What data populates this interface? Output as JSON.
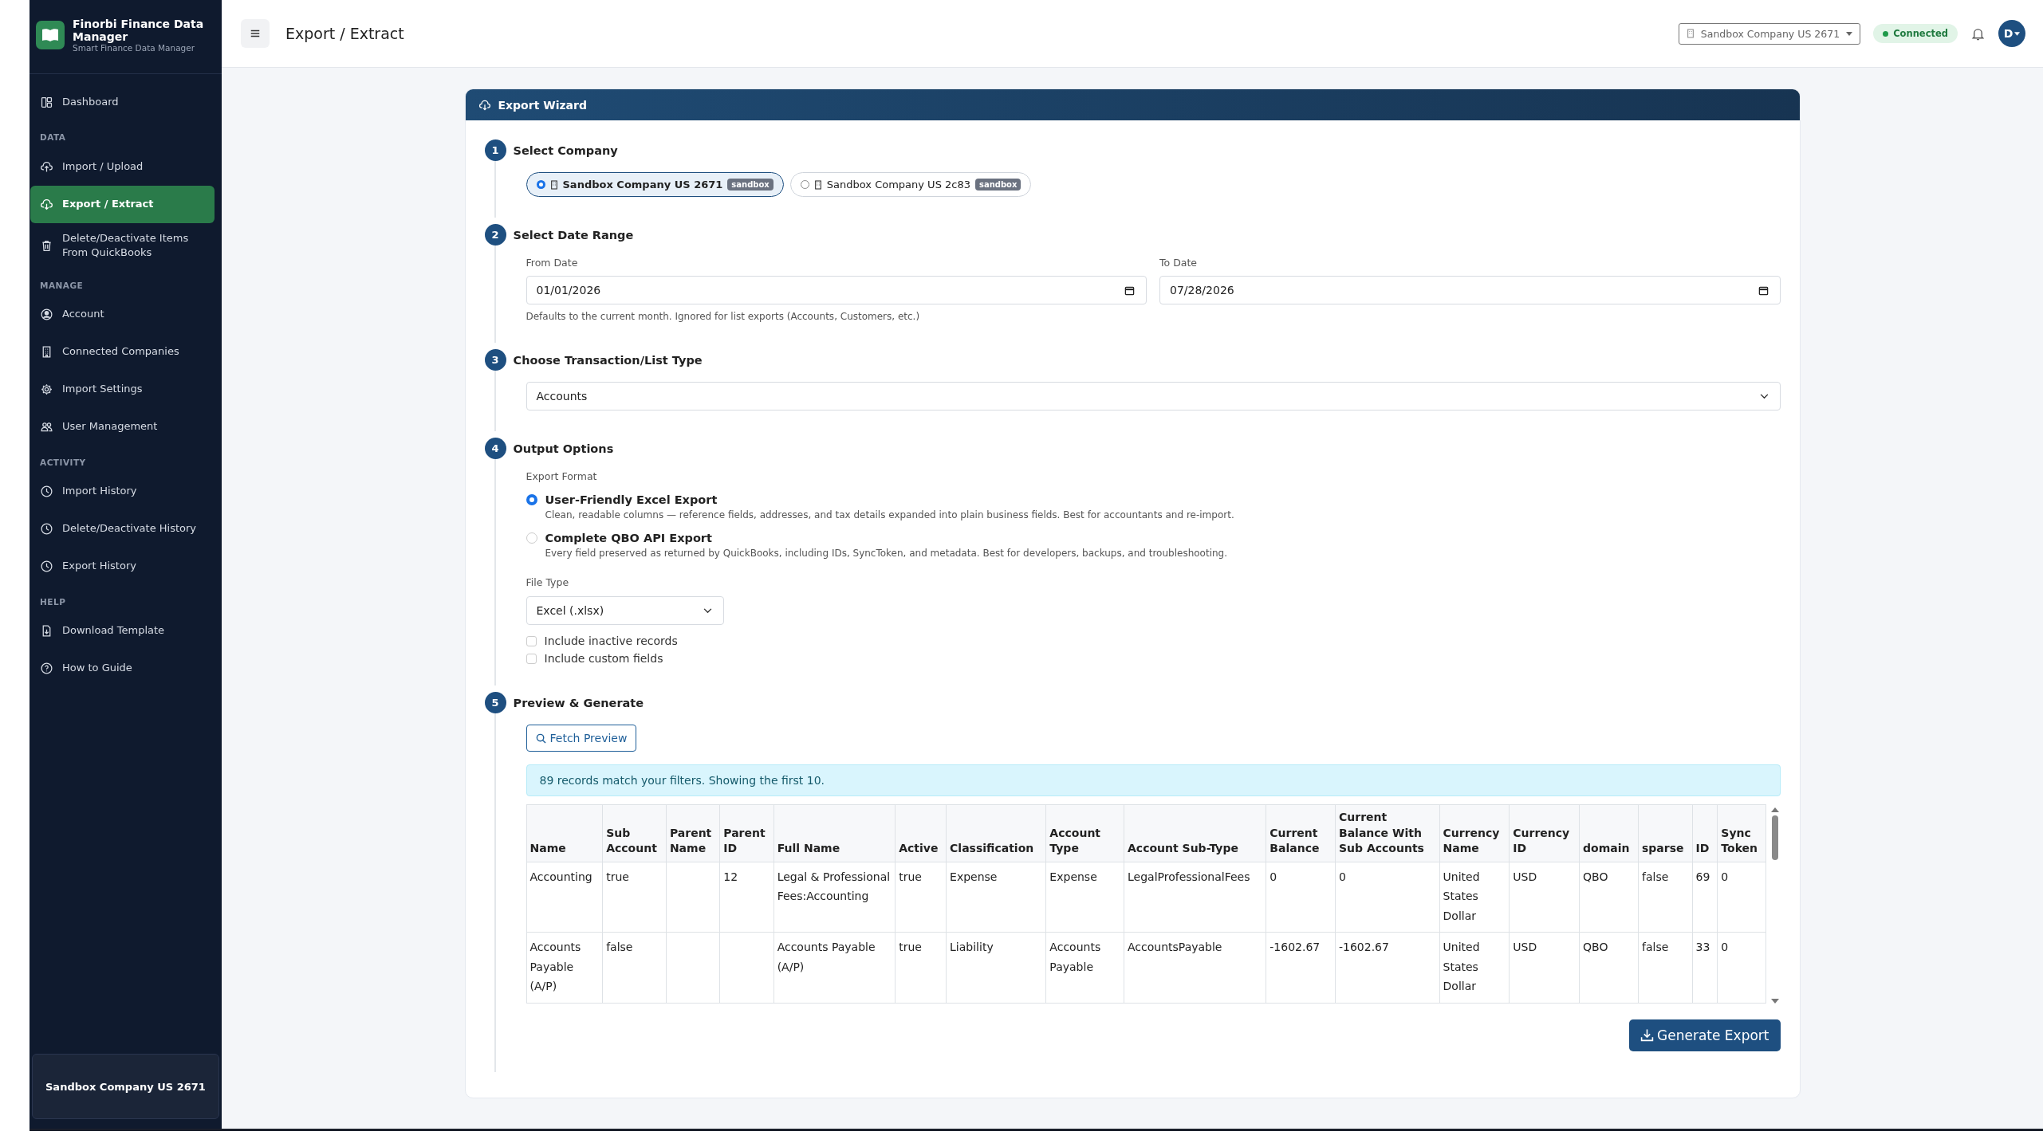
{
  "app": {
    "name": "Finorbi Finance Data Manager",
    "tagline": "Smart Finance Data Manager"
  },
  "sidebar": {
    "sections": [
      {
        "items": [
          {
            "label": "Dashboard",
            "kind": "dashboard",
            "selected": false
          }
        ]
      },
      {
        "heading": "DATA",
        "items": [
          {
            "label": "Import / Upload",
            "kind": "upload",
            "selected": false
          },
          {
            "label": "Export / Extract",
            "kind": "download",
            "selected": true
          },
          {
            "label": "Delete/Deactivate Items From QuickBooks",
            "kind": "trash",
            "selected": false
          }
        ]
      },
      {
        "heading": "MANAGE",
        "items": [
          {
            "label": "Account",
            "kind": "user",
            "selected": false
          },
          {
            "label": "Connected Companies",
            "kind": "building",
            "selected": false
          },
          {
            "label": "Import Settings",
            "kind": "gear",
            "selected": false
          },
          {
            "label": "User Management",
            "kind": "users",
            "selected": false
          }
        ]
      },
      {
        "heading": "ACTIVITY",
        "items": [
          {
            "label": "Import History",
            "kind": "history",
            "selected": false
          },
          {
            "label": "Delete/Deactivate History",
            "kind": "history",
            "selected": false
          },
          {
            "label": "Export History",
            "kind": "history",
            "selected": false
          }
        ]
      },
      {
        "heading": "HELP",
        "items": [
          {
            "label": "Download Template",
            "kind": "template",
            "selected": false
          },
          {
            "label": "How to Guide",
            "kind": "guide",
            "selected": false
          }
        ]
      }
    ],
    "footer": "Sandbox Company US 2671"
  },
  "topbar": {
    "title": "Export / Extract",
    "company": "Sandbox Company US 2671",
    "status": "Connected",
    "avatar": "D"
  },
  "wizard": {
    "title": "Export Wizard",
    "steps": [
      {
        "kind": "company",
        "number": "1",
        "title": "Select Company",
        "companies": [
          {
            "name": "Sandbox Company US 2671",
            "badge": "sandbox",
            "selected": true
          },
          {
            "name": "Sandbox Company US 2c83",
            "badge": "sandbox",
            "selected": false
          }
        ]
      },
      {
        "kind": "dates",
        "number": "2",
        "title": "Select Date Range",
        "from": {
          "label": "From Date",
          "value": "01/01/2026"
        },
        "to": {
          "label": "To Date",
          "value": "07/28/2026"
        },
        "hint": "Defaults to the current month. Ignored for list exports (Accounts, Customers, etc.)"
      },
      {
        "kind": "type",
        "number": "3",
        "title": "Choose Transaction/List Type",
        "value": "Accounts"
      },
      {
        "kind": "output",
        "number": "4",
        "title": "Output Options",
        "format_label": "Export Format",
        "formats": [
          {
            "title": "User-Friendly Excel Export",
            "description": "Clean, readable columns — reference fields, addresses, and tax details expanded into plain business fields. Best for accountants and re-import.",
            "selected": true
          },
          {
            "title": "Complete QBO API Export",
            "description": "Every field preserved as returned by QuickBooks, including IDs, SyncToken, and metadata. Best for developers, backups, and troubleshooting.",
            "selected": false
          }
        ],
        "file_type": {
          "label": "File Type",
          "value": "Excel (.xlsx)"
        },
        "options": [
          {
            "label": "Include inactive records",
            "checked": false
          },
          {
            "label": "Include custom fields",
            "checked": false
          }
        ]
      },
      {
        "kind": "preview",
        "number": "5",
        "title": "Preview & Generate",
        "fetch_button": "Fetch Preview",
        "info": "89 records match your filters. Showing the first 10.",
        "table": {
          "columns": [
            "Name",
            "Sub Account",
            "Parent Name",
            "Parent ID",
            "Full Name",
            "Active",
            "Classification",
            "Account Type",
            "Account Sub-Type",
            "Current Balance",
            "Current Balance With Sub Accounts",
            "Currency Name",
            "Currency ID",
            "domain",
            "sparse",
            "ID",
            "Sync Token"
          ],
          "rows": [
            [
              "Accounting",
              "true",
              "",
              "12",
              "Legal & Professional Fees:Accounting",
              "true",
              "Expense",
              "Expense",
              "LegalProfessionalFees",
              "0",
              "0",
              "United States Dollar",
              "USD",
              "QBO",
              "false",
              "69",
              "0"
            ],
            [
              "Accounts Payable (A/P)",
              "false",
              "",
              "",
              "Accounts Payable (A/P)",
              "true",
              "Liability",
              "Accounts Payable",
              "AccountsPayable",
              "-1602.67",
              "-1602.67",
              "United States Dollar",
              "USD",
              "QBO",
              "false",
              "33",
              "0"
            ]
          ]
        },
        "generate_button": "Generate Export"
      }
    ]
  }
}
